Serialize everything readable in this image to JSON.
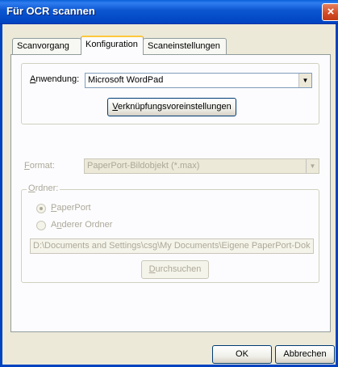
{
  "window": {
    "title": "Für OCR scannen",
    "close_glyph": "×"
  },
  "tabs": [
    {
      "label": "Scanvorgang"
    },
    {
      "label": "Konfiguration"
    },
    {
      "label": "Scaneinstellungen"
    }
  ],
  "application": {
    "label_accel": "A",
    "label_rest": "nwendung:",
    "selected": "Microsoft WordPad",
    "link_button_accel": "V",
    "link_button_rest": "erknüpfungsvoreinstellungen"
  },
  "format": {
    "label_accel": "F",
    "label_rest": "ormat:",
    "selected": "PaperPort-Bildobjekt (*.max)"
  },
  "folder": {
    "legend_accel": "O",
    "legend_rest": "rdner:",
    "option1_accel": "P",
    "option1_rest": "aperPort",
    "option2_pre": "A",
    "option2_accel": "n",
    "option2_rest": "derer Ordner",
    "path": "D:\\Documents and Settings\\csg\\My Documents\\Eigene PaperPort-Dok",
    "browse_accel": "D",
    "browse_rest": "urchsuchen"
  },
  "footer": {
    "ok": "OK",
    "cancel": "Abbrechen"
  }
}
